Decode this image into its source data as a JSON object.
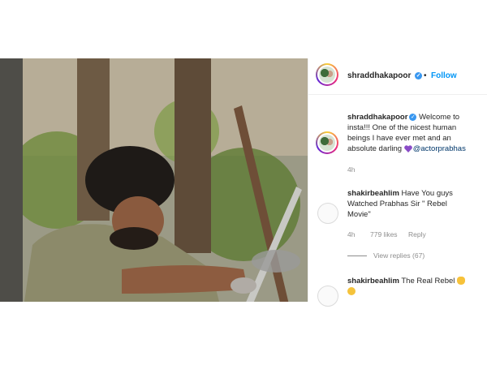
{
  "post": {
    "author": {
      "username": "shraddhakapoor",
      "separator": "•",
      "follow_label": "Follow"
    },
    "caption": {
      "username": "shraddhakapoor",
      "line1": "Welcome to",
      "line2": "insta!!! One of the nicest human",
      "line3": "beings I have ever met and an",
      "line4_pre": "absolute darling",
      "mention": "@actorprabhas",
      "time": "4h"
    },
    "comments": [
      {
        "username": "shakirbeahlim",
        "line1": "Have You guys",
        "line2": "Watched Prabhas Sir \" Rebel",
        "line3": "Movie\"",
        "time": "4h",
        "likes": "779 likes",
        "reply_label": "Reply",
        "view_replies": "View replies (67)"
      },
      {
        "username": "shakirbeahlim",
        "text": "The Real Rebel"
      }
    ]
  },
  "colors": {
    "accent": "#0095f6",
    "verified": "#3897f0",
    "muted": "#8e8e8e",
    "text": "#262626"
  },
  "icons": {
    "verified": "verified-badge-icon",
    "heart": "purple-heart-icon",
    "fist": "oncoming-fist-icon",
    "scream": "face-screaming-icon"
  }
}
